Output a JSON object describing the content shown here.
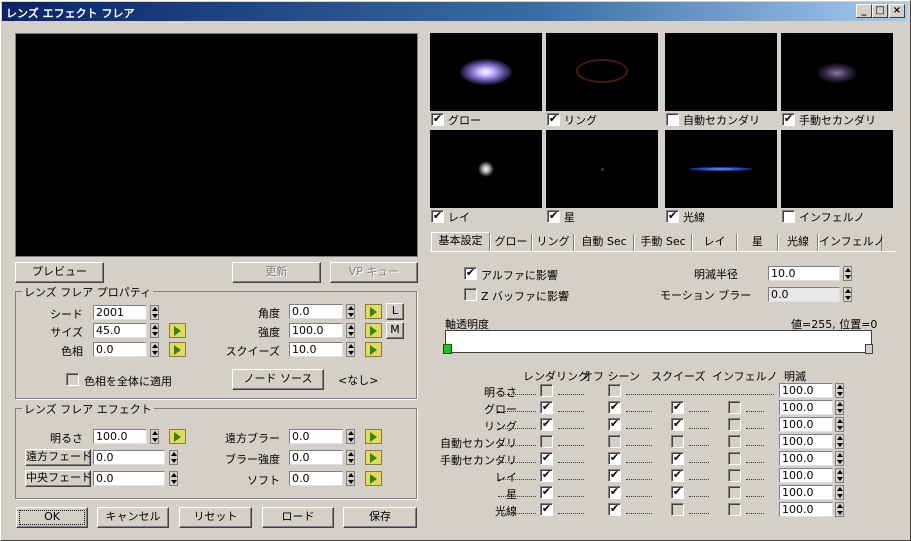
{
  "window": {
    "title": "レンズ エフェクト フレア",
    "min": "_",
    "max": "□",
    "close": "×"
  },
  "preview_buttons": {
    "preview": "プレビュー",
    "update": "更新",
    "vp_queue": "VP キュー"
  },
  "props": {
    "title": "レンズ フレア プロパティ",
    "seed_label": "シード",
    "seed": "2001",
    "size_label": "サイズ",
    "size": "45.0",
    "hue_label": "色相",
    "hue": "0.0",
    "angle_label": "角度",
    "angle": "0.0",
    "intensity_label": "強度",
    "intensity": "100.0",
    "squeeze_label": "スクイーズ",
    "squeeze": "10.0",
    "L": "L",
    "M": "M",
    "apply_hue": "色相を全体に適用",
    "node_source": "ノード ソース",
    "node_none": "<なし>"
  },
  "effects": {
    "title": "レンズ フレア エフェクト",
    "brightness_label": "明るさ",
    "brightness": "100.0",
    "far_fade": "遠方フェード",
    "far_fade_val": "0.0",
    "center_fade": "中央フェード",
    "center_fade_val": "0.0",
    "far_blur_label": "遠方ブラー",
    "far_blur": "0.0",
    "blur_int_label": "ブラー強度",
    "blur_int": "0.0",
    "soft_label": "ソフト",
    "soft": "0.0"
  },
  "bottom_buttons": {
    "ok": "OK",
    "cancel": "キャンセル",
    "reset": "リセット",
    "load": "ロード",
    "save": "保存"
  },
  "thumbs": [
    {
      "label": "グロー",
      "checked": "✔"
    },
    {
      "label": "リング",
      "checked": "✔"
    },
    {
      "label": "自動セカンダリ",
      "checked": ""
    },
    {
      "label": "手動セカンダリ",
      "checked": "✔"
    },
    {
      "label": "レイ",
      "checked": "✔"
    },
    {
      "label": "星",
      "checked": "✔"
    },
    {
      "label": "光線",
      "checked": "✔"
    },
    {
      "label": "インフェルノ",
      "checked": ""
    }
  ],
  "tabs": [
    "基本設定",
    "グロー",
    "リング",
    "自動 Sec",
    "手動 Sec",
    "レイ",
    "星",
    "光線",
    "インフェルノ"
  ],
  "prefs": {
    "alpha": "アルファに影響",
    "alpha_chk": "✔",
    "zbuf": "Z バッファに影響",
    "zbuf_chk": "",
    "blink_radius_label": "明滅半径",
    "blink_radius": "10.0",
    "motion_blur_label": "モーション ブラー",
    "motion_blur": "0.0",
    "axis_label": "軸透明度",
    "axis_value": "値=255, 位置=0"
  },
  "grid": {
    "headers": [
      "レンダリング",
      "オフ シーン",
      "スクイーズ",
      "インフェルノ",
      "明滅"
    ],
    "rows": [
      {
        "label": "明るさ",
        "r": "",
        "o": "",
        "s": "",
        "i": "",
        "v": "100.0"
      },
      {
        "label": "グロー",
        "r": "✔",
        "o": "✔",
        "s": "✔",
        "i": "",
        "v": "100.0"
      },
      {
        "label": "リング",
        "r": "✔",
        "o": "✔",
        "s": "✔",
        "i": "",
        "v": "100.0"
      },
      {
        "label": "自動セカンダリ",
        "r": "",
        "o": "",
        "s": "",
        "i": "",
        "v": "100.0"
      },
      {
        "label": "手動セカンダリ",
        "r": "✔",
        "o": "✔",
        "s": "✔",
        "i": "",
        "v": "100.0"
      },
      {
        "label": "レイ",
        "r": "✔",
        "o": "✔",
        "s": "✔",
        "i": "",
        "v": "100.0"
      },
      {
        "label": "星",
        "r": "✔",
        "o": "✔",
        "s": "✔",
        "i": "",
        "v": "100.0"
      },
      {
        "label": "光線",
        "r": "✔",
        "o": "✔",
        "s": "",
        "i": "",
        "v": "100.0"
      }
    ]
  }
}
